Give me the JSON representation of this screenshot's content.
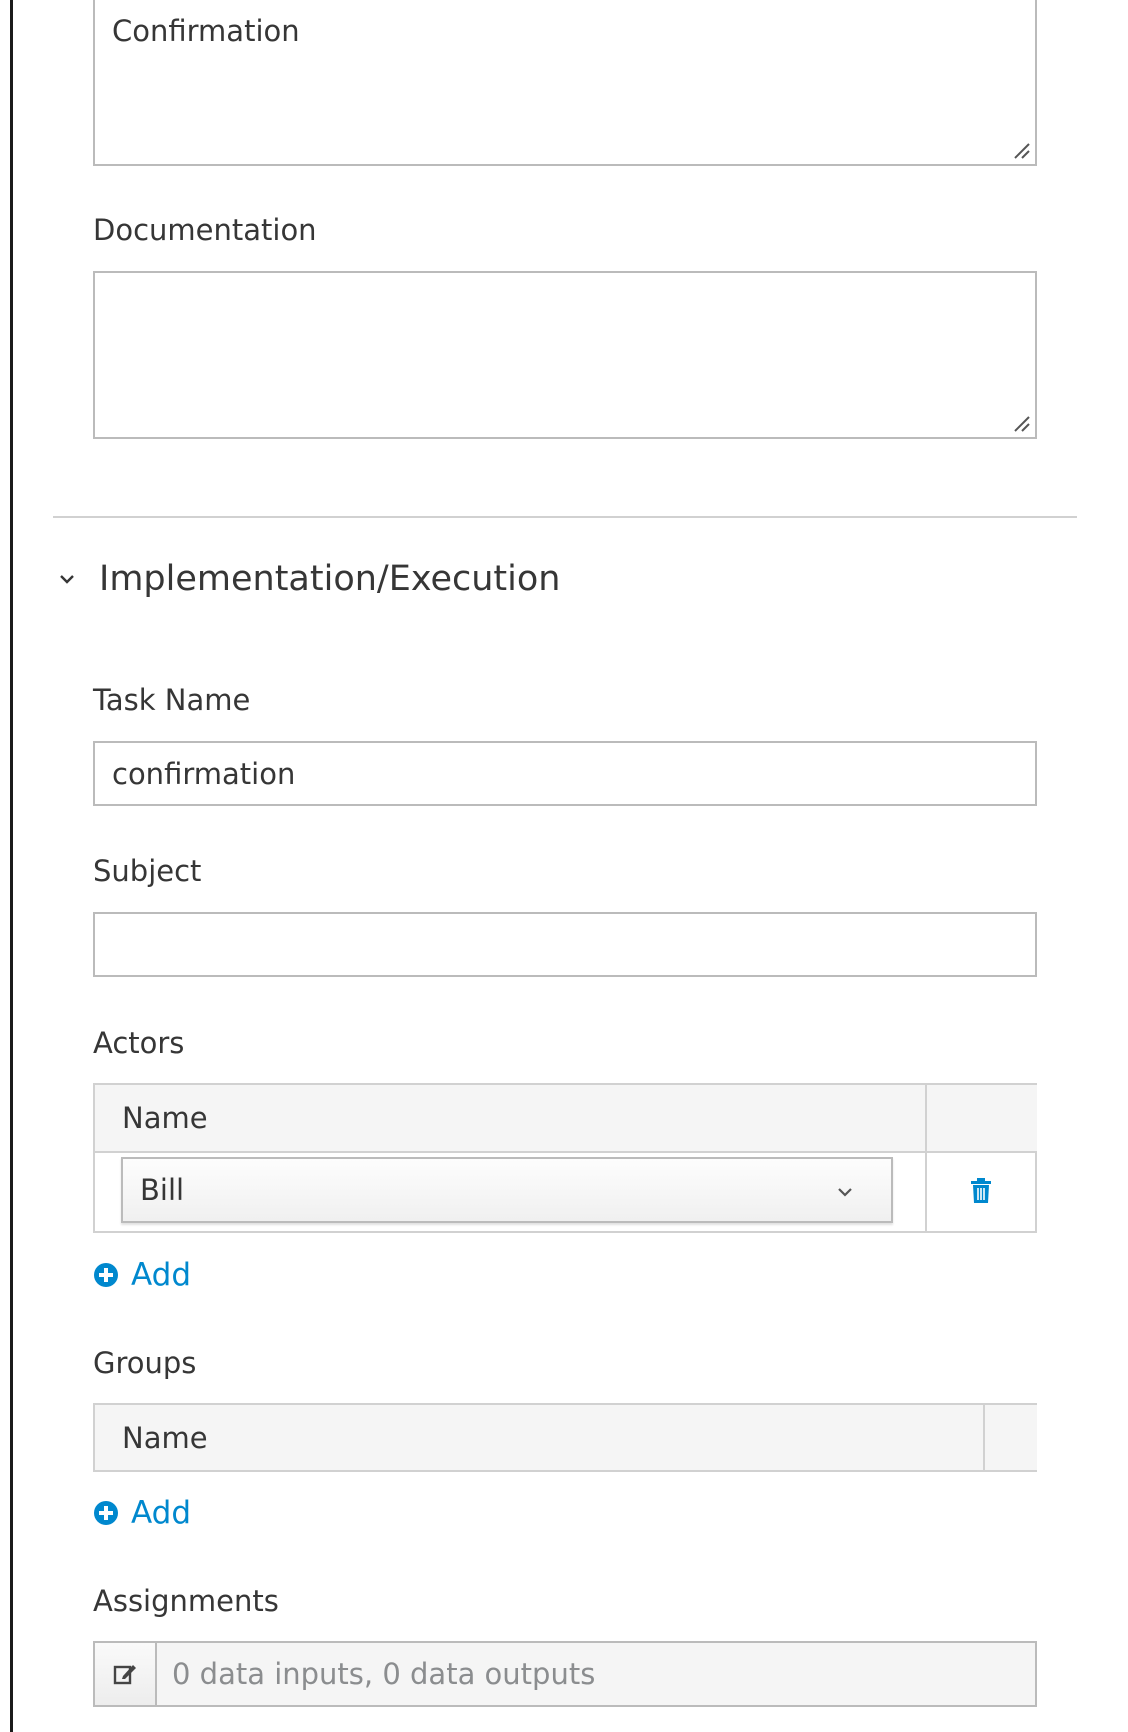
{
  "general": {
    "name_value": "Confirmation",
    "documentation_label": "Documentation",
    "documentation_value": ""
  },
  "implementation": {
    "section_title": "Implementation/Execution",
    "task_name_label": "Task Name",
    "task_name_value": "confirmation",
    "subject_label": "Subject",
    "subject_value": ""
  },
  "actors": {
    "label": "Actors",
    "column_name": "Name",
    "rows": [
      {
        "value": "Bill"
      }
    ],
    "add_label": "Add"
  },
  "groups": {
    "label": "Groups",
    "column_name": "Name",
    "add_label": "Add"
  },
  "assignments": {
    "label": "Assignments",
    "summary": "0 data inputs, 0 data outputs"
  },
  "colors": {
    "link": "#0088ce",
    "border": "#bbbbbb",
    "text": "#363636"
  }
}
